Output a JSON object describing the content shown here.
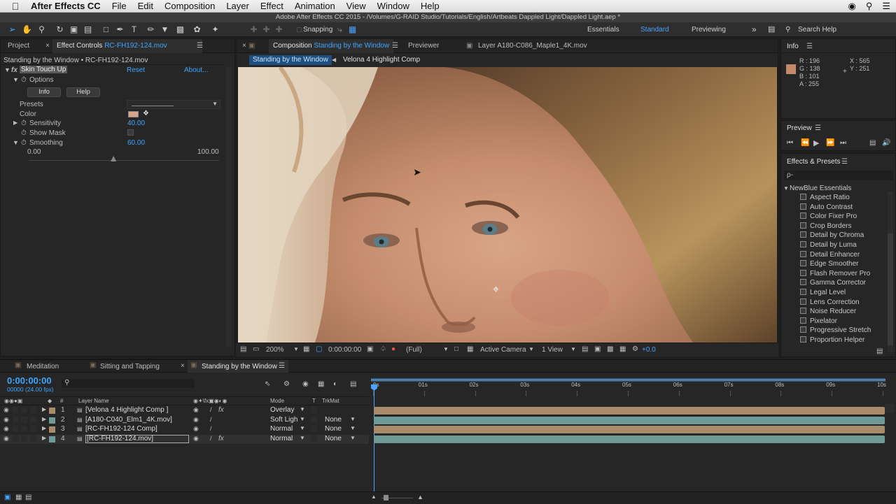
{
  "menubar": {
    "app_name": "After Effects CC",
    "items": [
      "File",
      "Edit",
      "Composition",
      "Layer",
      "Effect",
      "Animation",
      "View",
      "Window",
      "Help"
    ]
  },
  "window_title": "Adobe After Effects CC 2015 - /Volumes/G-RAID Studio/Tutorials/English/Artbeats Dappled Light/Dappled Light.aep *",
  "toolbar": {
    "snapping_label": "Snapping",
    "workspaces": [
      "Essentials",
      "Standard",
      "Previewing"
    ],
    "search_placeholder": "Search Help"
  },
  "left_panel": {
    "tabs": [
      "Project",
      "Effect Controls"
    ],
    "effect_controls_file": "RC-FH192-124.mov",
    "breadcrumb": "Standing by the Window • RC-FH192-124.mov",
    "effect_name": "Skin Touch Up",
    "reset_label": "Reset",
    "about_label": "About...",
    "options_label": "Options",
    "info_button": "Info",
    "help_button": "Help",
    "presets_label": "Presets",
    "color_label": "Color",
    "color_swatch": "#d8a48c",
    "sensitivity_label": "Sensitivity",
    "sensitivity_value": "40.00",
    "show_mask_label": "Show Mask",
    "smoothing_label": "Smoothing",
    "smoothing_value": "60.00",
    "slider_min": "0.00",
    "slider_max": "100.00",
    "smoothing_slider_fraction": 0.6
  },
  "comp_panel": {
    "comp_tab_prefix": "Composition",
    "comp_tab_name": "Standing by the Window",
    "previewer_tab": "Previewer",
    "layer_tab": "Layer A180-C086_Maple1_4K.mov",
    "breadcrumb_active": "Standing by the Window",
    "breadcrumb_next": "Velona 4 Highlight Comp",
    "zoom": "200%",
    "timecode": "0:00:00:00",
    "resolution": "(Full)",
    "camera": "Active Camera",
    "views": "1 View",
    "exposure": "+0.0"
  },
  "info_panel": {
    "title": "Info",
    "r": "R : 196",
    "g": "G : 138",
    "b": "B : 101",
    "a": "A : 255",
    "x": "X : 565",
    "y": "Y : 251",
    "swatch": "#c4896a"
  },
  "preview_panel": {
    "title": "Preview"
  },
  "effects_panel": {
    "title": "Effects & Presets",
    "search_placeholder": "ρ-",
    "category": "NewBlue Essentials",
    "items": [
      "Aspect Ratio",
      "Auto Contrast",
      "Color Fixer Pro",
      "Crop Borders",
      "Detail by Chroma",
      "Detail by Luma",
      "Detail Enhancer",
      "Edge Smoother",
      "Flash Remover Pro",
      "Gamma Corrector",
      "Legal Level",
      "Lens Correction",
      "Noise Reducer",
      "Pixelator",
      "Progressive Stretch",
      "Proportion Helper"
    ]
  },
  "timeline": {
    "tabs": [
      "Meditation",
      "Sitting and Tapping",
      "Standing by the Window"
    ],
    "timecode": "0:00:00:00",
    "frames": "00000 (24.00 fps)",
    "col_layer_name": "Layer Name",
    "col_mode": "Mode",
    "col_t": "T",
    "col_trkmat": "TrkMat",
    "ruler": [
      "0s",
      "01s",
      "02s",
      "03s",
      "04s",
      "05s",
      "06s",
      "07s",
      "08s",
      "09s",
      "10s"
    ],
    "layers": [
      {
        "num": "1",
        "name": "[Velona 4 Highlight Comp ]",
        "mode": "Overlay",
        "trkmat": "",
        "color": "#a88b6a"
      },
      {
        "num": "2",
        "name": "[A180-C040_Elm1_4K.mov]",
        "mode": "Soft Ligh",
        "trkmat": "None",
        "color": "#6f9a98"
      },
      {
        "num": "3",
        "name": "[RC-FH192-124 Comp]",
        "mode": "Normal",
        "trkmat": "None",
        "color": "#a88b6a"
      },
      {
        "num": "4",
        "name": "[RC-FH192-124.mov]",
        "mode": "Normal",
        "trkmat": "None",
        "color": "#6f9a98"
      }
    ]
  }
}
